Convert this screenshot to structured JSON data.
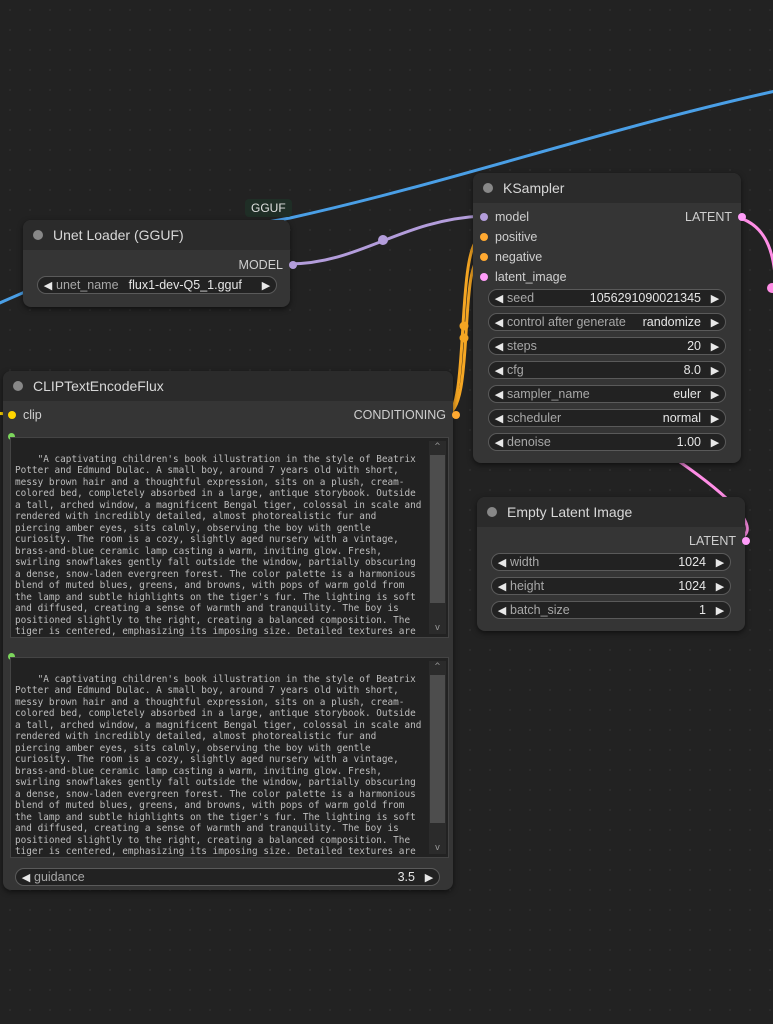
{
  "colors": {
    "model_link": "#b39ddb",
    "clip_link": "#4a9fe6",
    "conditioning_link": "#f5a623",
    "latent_link": "#ff8ee6",
    "model_dot": "#b39ddb",
    "clip_dot": "#ffd500",
    "conditioning_dot": "#ffa931",
    "latent_dot": "#ff9cf9",
    "text_dot": "#7cd65c"
  },
  "link_label": "GGUF",
  "unet_loader": {
    "title": "Unet Loader (GGUF)",
    "output": "MODEL",
    "widget_label": "unet_name",
    "widget_value": "flux1-dev-Q5_1.gguf"
  },
  "ksampler": {
    "title": "KSampler",
    "inputs": [
      "model",
      "positive",
      "negative",
      "latent_image"
    ],
    "output": "LATENT",
    "widgets": [
      {
        "label": "seed",
        "value": "1056291090021345"
      },
      {
        "label": "control after generate",
        "value": "randomize"
      },
      {
        "label": "steps",
        "value": "20"
      },
      {
        "label": "cfg",
        "value": "8.0"
      },
      {
        "label": "sampler_name",
        "value": "euler"
      },
      {
        "label": "scheduler",
        "value": "normal"
      },
      {
        "label": "denoise",
        "value": "1.00"
      }
    ]
  },
  "empty_latent": {
    "title": "Empty Latent Image",
    "output": "LATENT",
    "widgets": [
      {
        "label": "width",
        "value": "1024"
      },
      {
        "label": "height",
        "value": "1024"
      },
      {
        "label": "batch_size",
        "value": "1"
      }
    ]
  },
  "clip_encode": {
    "title": "CLIPTextEncodeFlux",
    "input": "clip",
    "output": "CONDITIONING",
    "prompt_1": "\"A captivating children's book illustration in the style of Beatrix Potter and Edmund Dulac. A small boy, around 7 years old with short, messy brown hair and a thoughtful expression, sits on a plush, cream-colored bed, completely absorbed in a large, antique storybook. Outside a tall, arched window, a magnificent Bengal tiger, colossal in scale and rendered with incredibly detailed, almost photorealistic fur and piercing amber eyes, sits calmly, observing the boy with gentle curiosity. The room is a cozy, slightly aged nursery with a vintage, brass-and-blue ceramic lamp casting a warm, inviting glow. Fresh, swirling snowflakes gently fall outside the window, partially obscuring a dense, snow-laden evergreen forest. The color palette is a harmonious blend of muted blues, greens, and browns, with pops of warm gold from the lamp and subtle highlights on the tiger's fur. The lighting is soft and diffused, creating a sense of warmth and tranquility. The boy is positioned slightly to the right, creating a balanced composition. The tiger is centered, emphasizing its imposing size. Detailed textures are key - the plush fabric of the bed, the worn pages of the book, the intricate details of the tiger's fur. 8k, highly detailed, storybook illustration, magical realism, warm lighting, intricate textures, Beatrix",
    "prompt_2": "\"A captivating children's book illustration in the style of Beatrix Potter and Edmund Dulac. A small boy, around 7 years old with short, messy brown hair and a thoughtful expression, sits on a plush, cream-colored bed, completely absorbed in a large, antique storybook. Outside a tall, arched window, a magnificent Bengal tiger, colossal in scale and rendered with incredibly detailed, almost photorealistic fur and piercing amber eyes, sits calmly, observing the boy with gentle curiosity. The room is a cozy, slightly aged nursery with a vintage, brass-and-blue ceramic lamp casting a warm, inviting glow. Fresh, swirling snowflakes gently fall outside the window, partially obscuring a dense, snow-laden evergreen forest. The color palette is a harmonious blend of muted blues, greens, and browns, with pops of warm gold from the lamp and subtle highlights on the tiger's fur. The lighting is soft and diffused, creating a sense of warmth and tranquility. The boy is positioned slightly to the right, creating a balanced composition. The tiger is centered, emphasizing its imposing size. Detailed textures are key - the plush fabric of the bed, the worn pages of the book, the intricate details of the tiger's fur. 8k, highly detailed, storybook illustration, magical realism, warm lighting, intricate textures, Beatrix",
    "guidance_label": "guidance",
    "guidance_value": "3.5"
  }
}
